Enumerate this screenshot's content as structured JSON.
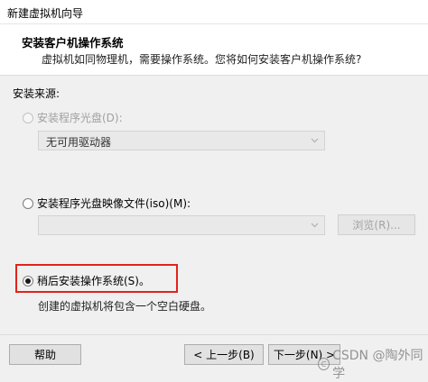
{
  "window": {
    "title": "新建虚拟机向导"
  },
  "header": {
    "title": "安装客户机操作系统",
    "subtitle": "虚拟机如同物理机，需要操作系统。您将如何安装客户机操作系统?"
  },
  "section": {
    "label": "安装来源:"
  },
  "options": {
    "disc": {
      "label": "安装程序光盘(D):",
      "enabled": false,
      "selected": false,
      "drive_value": "无可用驱动器"
    },
    "iso": {
      "label": "安装程序光盘映像文件(iso)(M):",
      "enabled": true,
      "selected": false,
      "path_value": "",
      "browse_label": "浏览(R)..."
    },
    "later": {
      "label": "稍后安装操作系统(S)。",
      "enabled": true,
      "selected": true,
      "note": "创建的虚拟机将包含一个空白硬盘。"
    }
  },
  "footer": {
    "help_label": "帮助",
    "back_label": "< 上一步(B)",
    "next_label": "下一步(N) >"
  },
  "watermark": {
    "text": "CSDN @陶外同学"
  },
  "colors": {
    "highlight": "#e2231a"
  }
}
